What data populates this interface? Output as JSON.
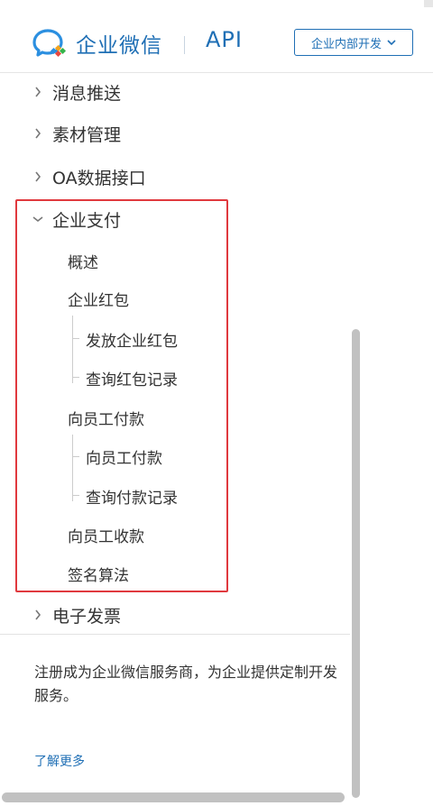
{
  "header": {
    "brand": "企业微信",
    "api": "API",
    "dropdown_label": "企业内部开发",
    "logo_icon": "wework-logo-icon",
    "brand_color": "#1f6fb5"
  },
  "sidebar": {
    "items": [
      {
        "label": "消息推送",
        "expanded": false
      },
      {
        "label": "素材管理",
        "expanded": false
      },
      {
        "label": "OA数据接口",
        "expanded": false
      },
      {
        "label": "企业支付",
        "expanded": true
      },
      {
        "label": "电子发票",
        "expanded": false
      }
    ],
    "pay_children": {
      "overview": "概述",
      "red_packet": "企业红包",
      "red_packet_send": "发放企业红包",
      "red_packet_query": "查询红包记录",
      "pay_employee": "向员工付款",
      "pay_employee_send": "向员工付款",
      "pay_employee_query": "查询付款记录",
      "collect_employee": "向员工收款",
      "signature": "签名算法"
    },
    "highlight_color": "#e0393e"
  },
  "promo": {
    "text": "注册成为企业微信服务商，为企业提供定制开发服务。",
    "more_link": "了解更多"
  }
}
